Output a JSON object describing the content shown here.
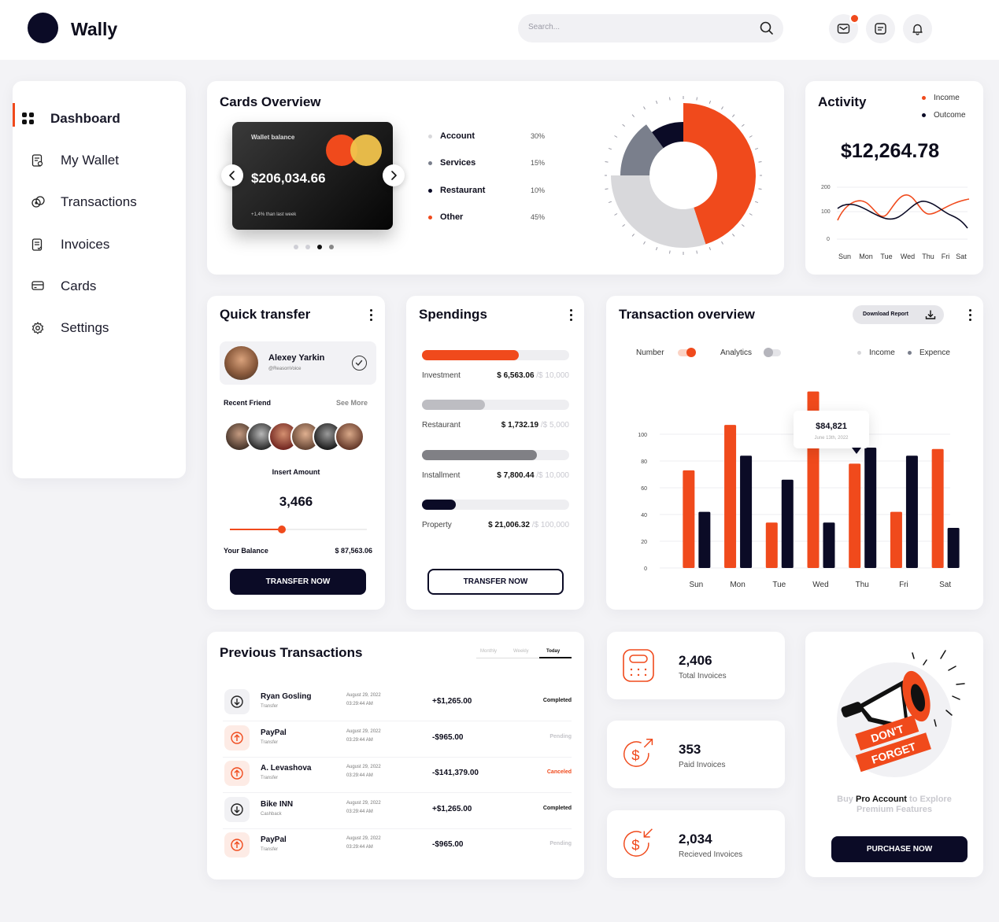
{
  "app": {
    "title": "Wally"
  },
  "search": {
    "placeholder": "Search..."
  },
  "sidebar": {
    "items": [
      {
        "label": "Dashboard",
        "icon": "dashboard-grid-icon",
        "active": true
      },
      {
        "label": "My Wallet",
        "icon": "wallet-icon"
      },
      {
        "label": "Transactions",
        "icon": "transactions-icon"
      },
      {
        "label": "Invoices",
        "icon": "invoice-icon"
      },
      {
        "label": "Cards",
        "icon": "card-icon"
      },
      {
        "label": "Settings",
        "icon": "gear-icon"
      }
    ]
  },
  "cards_overview": {
    "title": "Cards Overview",
    "card": {
      "label": "Wallet balance",
      "value": "$206,034.66",
      "change": "+1,4% than last week"
    },
    "legend": [
      {
        "label": "Account",
        "percent": "30%",
        "color": "#d8d8db"
      },
      {
        "label": "Services",
        "percent": "15%",
        "color": "#7a7f8c"
      },
      {
        "label": "Restaurant",
        "percent": "10%",
        "color": "#0b0b26"
      },
      {
        "label": "Other",
        "percent": "45%",
        "color": "#f04a1c"
      }
    ]
  },
  "activity": {
    "title": "Activity",
    "legend": [
      {
        "label": "Income",
        "color": "#f04a1c"
      },
      {
        "label": "Outcome",
        "color": "#0b0b26"
      }
    ],
    "value": "$12,264.78",
    "y_ticks": [
      "200",
      "100",
      "0"
    ],
    "x_labels": [
      "Sun",
      "Mon",
      "Tue",
      "Wed",
      "Thu",
      "Fri",
      "Sat"
    ]
  },
  "quick_transfer": {
    "title": "Quick transfer",
    "contact": {
      "name": "Alexey Yarkin",
      "handle": "@ReasonVoice"
    },
    "recent_label": "Recent Friend",
    "see_more": "See More",
    "insert_label": "Insert Amount",
    "amount": "3,466",
    "slider_fraction": 0.38,
    "balance_label": "Your Balance",
    "balance_value": "$ 87,563.06",
    "button": "TRANSFER NOW"
  },
  "spendings": {
    "title": "Spendings",
    "items": [
      {
        "label": "Investment",
        "value": "$ 6,563.06",
        "limit": "/$ 10,000",
        "fraction": 0.656,
        "color": "#f04a1c"
      },
      {
        "label": "Restaurant",
        "value": "$ 1,732.19",
        "limit": "/$ 5,000",
        "fraction": 0.43,
        "color": "#bdbdc2"
      },
      {
        "label": "Installment",
        "value": "$ 7,800.44",
        "limit": "/$ 10,000",
        "fraction": 0.78,
        "color": "#808085"
      },
      {
        "label": "Property",
        "value": "$ 21,006.32",
        "limit": "/$ 100,000",
        "fraction": 0.23,
        "color": "#0b0b26"
      }
    ],
    "button": "TRANSFER NOW"
  },
  "transaction_overview": {
    "title": "Transaction overview",
    "download": "Download Report",
    "toggles": [
      {
        "label": "Number",
        "on": true
      },
      {
        "label": "Analytics",
        "on": false
      }
    ],
    "legend": [
      {
        "label": "Income",
        "color": "#d8d8db"
      },
      {
        "label": "Expence",
        "color": "#7a7f8c"
      }
    ],
    "tooltip": {
      "value": "$84,821",
      "date": "June 13th, 2022"
    }
  },
  "chart_data": {
    "type": "bar",
    "categories": [
      "Sun",
      "Mon",
      "Tue",
      "Wed",
      "Thu",
      "Fri",
      "Sat"
    ],
    "series": [
      {
        "values": [
          73,
          107,
          34,
          132,
          78,
          42,
          89
        ],
        "color": "#f04a1c"
      },
      {
        "values": [
          42,
          84,
          66,
          34,
          90,
          84,
          30
        ],
        "color": "#0b0b26"
      }
    ],
    "y_ticks": [
      0,
      20,
      40,
      60,
      80,
      100
    ],
    "ylim": [
      0,
      130
    ],
    "grid": true
  },
  "previous_transactions": {
    "title": "Previous Transactions",
    "tabs": [
      {
        "label": "Monthly"
      },
      {
        "label": "Weekly"
      },
      {
        "label": "Today",
        "active": true
      }
    ],
    "rows": [
      {
        "name": "Ryan Gosling",
        "type": "Transfer",
        "date": "August 29, 2022",
        "time": "03:29:44 AM",
        "amount": "+$1,265.00",
        "status": "Completed",
        "status_color": "#111111",
        "icon": "arrow-down-icon",
        "icon_bg": "#f1f1f4",
        "icon_color": "#222222"
      },
      {
        "name": "PayPal",
        "type": "Transfer",
        "date": "August 29, 2022",
        "time": "03:29:44 AM",
        "amount": "-$965.00",
        "status": "Pending",
        "status_color": "#c4c4c9",
        "icon": "arrow-up-icon",
        "icon_bg": "#fdebe5",
        "icon_color": "#f04a1c"
      },
      {
        "name": "A. Levashova",
        "type": "Transfer",
        "date": "August 29, 2022",
        "time": "03:29:44 AM",
        "amount": "-$141,379.00",
        "status": "Canceled",
        "status_color": "#f04a1c",
        "icon": "arrow-up-icon",
        "icon_bg": "#fdebe5",
        "icon_color": "#f04a1c"
      },
      {
        "name": "Bike INN",
        "type": "Cashback",
        "date": "August 29, 2022",
        "time": "03:29:44 AM",
        "amount": "+$1,265.00",
        "status": "Completed",
        "status_color": "#111111",
        "icon": "arrow-down-icon",
        "icon_bg": "#f1f1f4",
        "icon_color": "#222222"
      },
      {
        "name": "PayPal",
        "type": "Transfer",
        "date": "August 29, 2022",
        "time": "03:29:44 AM",
        "amount": "-$965.00",
        "status": "Pending",
        "status_color": "#c4c4c9",
        "icon": "arrow-up-icon",
        "icon_bg": "#fdebe5",
        "icon_color": "#f04a1c"
      }
    ]
  },
  "invoices": [
    {
      "value": "2,406",
      "label": "Total Invoices",
      "icon": "calculator-icon"
    },
    {
      "value": "353",
      "label": "Paid Invoices",
      "icon": "dollar-out-icon"
    },
    {
      "value": "2,034",
      "label": "Recieved Invoices",
      "icon": "dollar-in-icon"
    }
  ],
  "promo": {
    "badge_line1": "DON'T",
    "badge_line2": "FORGET",
    "pre": "Buy",
    "highlight": "Pro Account",
    "post": "to Explore Premium Features",
    "button": "PURCHASE NOW"
  },
  "colors": {
    "accent": "#f04a1c",
    "dark": "#0b0b26",
    "grey": "#7a7f8c",
    "light": "#d8d8db"
  }
}
